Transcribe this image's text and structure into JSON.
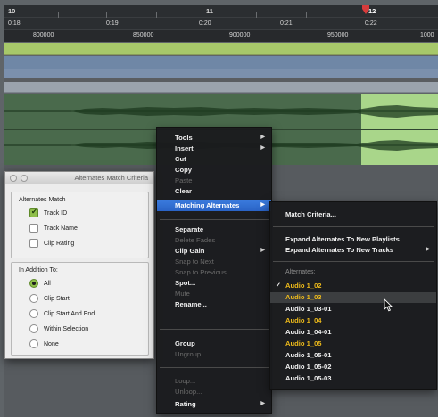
{
  "rulers": {
    "bars": [
      {
        "label": "10",
        "bold": true
      },
      {
        "label": "11",
        "bold": true
      },
      {
        "label": "12",
        "bold": true
      }
    ],
    "minsecs": [
      "0:18",
      "0:19",
      "0:20",
      "0:21",
      "0:22"
    ],
    "samples": [
      "800000",
      "850000",
      "900000",
      "950000",
      "1000"
    ]
  },
  "context_menu": {
    "items": [
      {
        "label": "Tools",
        "submenu": true,
        "disabled": false
      },
      {
        "label": "Insert",
        "submenu": true,
        "disabled": false
      },
      {
        "label": "Cut",
        "submenu": false,
        "disabled": false
      },
      {
        "label": "Copy",
        "submenu": false,
        "disabled": false
      },
      {
        "label": "Paste",
        "submenu": false,
        "disabled": true
      },
      {
        "label": "Clear",
        "submenu": false,
        "disabled": false
      },
      {
        "label": "Matching Alternates",
        "submenu": true,
        "disabled": false,
        "highlighted": true
      },
      {
        "label": "Separate",
        "submenu": false,
        "disabled": false
      },
      {
        "label": "Delete Fades",
        "submenu": false,
        "disabled": true
      },
      {
        "label": "Clip Gain",
        "submenu": true,
        "disabled": false
      },
      {
        "label": "Snap to Next",
        "submenu": false,
        "disabled": true
      },
      {
        "label": "Snap to Previous",
        "submenu": false,
        "disabled": true
      },
      {
        "label": "Spot...",
        "submenu": false,
        "disabled": false
      },
      {
        "label": "Mute",
        "submenu": false,
        "disabled": true
      },
      {
        "label": "Rename...",
        "submenu": false,
        "disabled": false
      },
      {
        "label": "Group",
        "submenu": false,
        "disabled": false
      },
      {
        "label": "Ungroup",
        "submenu": false,
        "disabled": true
      },
      {
        "label": "Loop...",
        "submenu": false,
        "disabled": true
      },
      {
        "label": "Unloop...",
        "submenu": false,
        "disabled": true
      },
      {
        "label": "Rating",
        "submenu": true,
        "disabled": false
      }
    ]
  },
  "submenu": {
    "match_criteria": "Match Criteria...",
    "expand_playlists": "Expand Alternates To New Playlists",
    "expand_tracks": "Expand Alternates To New Tracks",
    "alternates_heading": "Alternates:",
    "alternates": [
      {
        "label": "Audio 1_02",
        "color": "yellow",
        "checked": true
      },
      {
        "label": "Audio 1_03",
        "color": "yellow",
        "checked": false,
        "hover": true
      },
      {
        "label": "Audio 1_03-01",
        "color": "white",
        "checked": false
      },
      {
        "label": "Audio 1_04",
        "color": "yellow",
        "checked": false
      },
      {
        "label": "Audio 1_04-01",
        "color": "white",
        "checked": false
      },
      {
        "label": "Audio 1_05",
        "color": "yellow",
        "checked": false
      },
      {
        "label": "Audio 1_05-01",
        "color": "white",
        "checked": false
      },
      {
        "label": "Audio 1_05-02",
        "color": "white",
        "checked": false
      },
      {
        "label": "Audio 1_05-03",
        "color": "white",
        "checked": false
      }
    ]
  },
  "amc_window": {
    "title": "Alternates Match Criteria",
    "match_label": "Alternates Match",
    "match_options": [
      {
        "label": "Track ID",
        "checked": true
      },
      {
        "label": "Track Name",
        "checked": false
      },
      {
        "label": "Clip Rating",
        "checked": false
      }
    ],
    "addition_label": "In Addition To:",
    "addition_options": [
      {
        "label": "All",
        "selected": true
      },
      {
        "label": "Clip Start",
        "selected": false
      },
      {
        "label": "Clip Start And End",
        "selected": false
      },
      {
        "label": "Within Selection",
        "selected": false
      },
      {
        "label": "None",
        "selected": false
      }
    ]
  },
  "colors": {
    "yellow_alt": "#f0bc1a",
    "highlight": "#2f6fd6",
    "selection": "#a9d68a",
    "cursor": "#d0393a"
  }
}
